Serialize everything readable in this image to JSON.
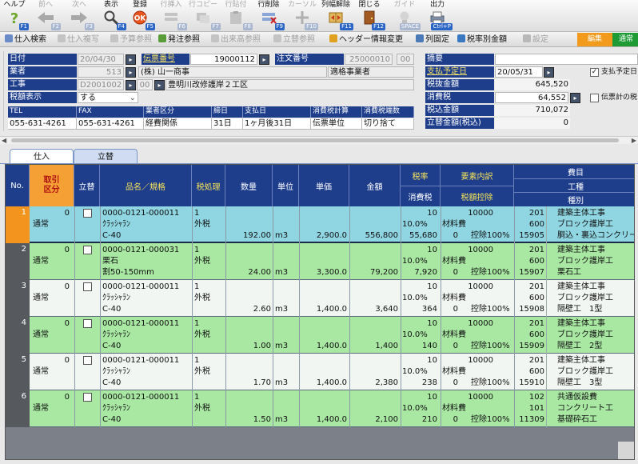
{
  "toolbar": [
    {
      "label": "ヘルプ",
      "key": "F1",
      "icon": "help-icon",
      "enabled": true
    },
    {
      "label": "前へ",
      "key": "F2",
      "icon": "arrow-left-icon",
      "enabled": false
    },
    {
      "label": "次へ",
      "key": "F3",
      "icon": "arrow-right-icon",
      "enabled": false
    },
    {
      "label": "表示",
      "key": "F4",
      "icon": "search-icon",
      "enabled": true
    },
    {
      "label": "登録",
      "key": "F5",
      "icon": "ok-icon",
      "enabled": true
    },
    {
      "label": "行挿入",
      "key": "F6",
      "icon": "row-insert-icon",
      "enabled": false
    },
    {
      "label": "行コピー",
      "key": "F7",
      "icon": "row-copy-icon",
      "enabled": false
    },
    {
      "label": "行貼付",
      "key": "F8",
      "icon": "row-paste-icon",
      "enabled": false
    },
    {
      "label": "行削除",
      "key": "F9",
      "icon": "row-delete-icon",
      "enabled": true
    },
    {
      "label": "カーソル",
      "key": "F10",
      "icon": "cursor-icon",
      "enabled": false
    },
    {
      "label": "列幅解除",
      "key": "F11",
      "icon": "column-width-icon",
      "enabled": true
    },
    {
      "label": "閉じる",
      "key": "F12",
      "icon": "close-door-icon",
      "enabled": true
    },
    {
      "label": "ガイド",
      "key": "SPACE",
      "icon": "guide-bulb-icon",
      "enabled": false
    },
    {
      "label": "出力",
      "key": "Ctrl+P",
      "icon": "printer-icon",
      "enabled": true
    }
  ],
  "toolbar2": [
    {
      "label": "仕入検索",
      "icon": "search-icon",
      "enabled": true
    },
    {
      "label": "仕入複写",
      "icon": "copy-icon",
      "enabled": false
    },
    {
      "label": "予算参照",
      "icon": "budget-icon",
      "enabled": false
    },
    {
      "label": "発注参照",
      "icon": "order-icon",
      "enabled": true
    },
    {
      "label": "出来高参照",
      "icon": "progress-icon",
      "enabled": false
    },
    {
      "label": "立替参照",
      "icon": "advance-icon",
      "enabled": false
    },
    {
      "label": "ヘッダー情報変更",
      "icon": "header-edit-icon",
      "enabled": true
    },
    {
      "label": "列固定",
      "icon": "column-lock-icon",
      "enabled": true
    },
    {
      "label": "税率別金額",
      "icon": "tax-rate-icon",
      "enabled": true
    },
    {
      "label": "設定",
      "icon": "settings-icon",
      "enabled": false
    }
  ],
  "mode_buttons": {
    "edit": "編集",
    "normal": "通常"
  },
  "header": {
    "date_label": "日付",
    "date": "20/04/30",
    "slip_label": "伝票番号",
    "slip_no": "19000112",
    "order_label": "注文番号",
    "order_no1": "25000010",
    "order_no2": "00",
    "vendor_label": "業者",
    "vendor_code": "513",
    "vendor_name": "(株) 山一商事",
    "vendor_type": "適格事業者",
    "work_label": "工事",
    "work_code": "D2001002",
    "work_sub": "00",
    "work_name": "豊明川改修護岸２工区",
    "tax_label": "税額表示",
    "tax_value": "する",
    "grid_headers": [
      "TEL",
      "FAX",
      "業者区分",
      "締日",
      "支払日",
      "消費税計算",
      "消費税端数"
    ],
    "grid_values": [
      "055-631-4261",
      "055-631-4261",
      "経費関係",
      "31日",
      "1ヶ月後31日",
      "伝票単位",
      "切り捨て"
    ]
  },
  "summary": {
    "memo_label": "摘要",
    "memo": "",
    "pay_due_label": "支払予定日",
    "pay_due": "20/05/31",
    "excl_label": "税抜金額",
    "excl": "645,520",
    "tax_label": "消費税",
    "tax": "64,552",
    "incl_label": "税込金額",
    "incl": "710,072",
    "advance_label": "立替金額(税込)",
    "advance": "0",
    "chk_pay_due": "支払予定日",
    "chk_slip_tax": "伝票計の税"
  },
  "tabs": [
    {
      "label": "仕入",
      "active": true
    },
    {
      "label": "立替",
      "active": false
    }
  ],
  "columns": {
    "no": "No.",
    "kbn": "取引\n区分",
    "tatekae": "立替",
    "item": "品名／規格",
    "taxproc": "税処理",
    "qty": "数量",
    "unit": "単位",
    "price": "単価",
    "amount": "金額",
    "taxrate": "税率",
    "consumption": "消費税",
    "element": "要素内訳",
    "deduction": "税額控除",
    "cost": "費目",
    "process": "工種",
    "kind": "種別"
  },
  "rows": [
    {
      "no": "1",
      "kbn_code": "0",
      "kbn": "通常",
      "code": "0000-0121-000011",
      "name": "ｸﾗｯｼｬﾗﾝ",
      "spec": "C-40",
      "tax_code": "1",
      "tax": "外税",
      "qty": "192.00",
      "unit": "m3",
      "price": "2,900.0",
      "amount": "556,800",
      "rate_val": "10",
      "rate": "10.0%",
      "ctax": "55,680",
      "el_code": "10000",
      "el": "材料費",
      "el_sub": "0",
      "deduct": "控除100%",
      "cost_code": "201",
      "cost": "建築主体工事",
      "proc_code": "600",
      "proc": "ブロック護岸工",
      "kind_code": "15905",
      "kind": "胴込・裏込コンクリート料",
      "selected": true
    },
    {
      "no": "2",
      "kbn_code": "0",
      "kbn": "通常",
      "code": "0000-0121-000031",
      "name": "栗石",
      "spec": "割50-150mm",
      "tax_code": "1",
      "tax": "外税",
      "qty": "24.00",
      "unit": "m3",
      "price": "3,300.0",
      "amount": "79,200",
      "rate_val": "10",
      "rate": "10.0%",
      "ctax": "7,920",
      "el_code": "10000",
      "el": "材料費",
      "el_sub": "0",
      "deduct": "控除100%",
      "cost_code": "201",
      "cost": "建築主体工事",
      "proc_code": "600",
      "proc": "ブロック護岸工",
      "kind_code": "15907",
      "kind": "栗石工",
      "selected": false
    },
    {
      "no": "3",
      "kbn_code": "0",
      "kbn": "通常",
      "code": "0000-0121-000011",
      "name": "ｸﾗｯｼｬﾗﾝ",
      "spec": "C-40",
      "tax_code": "1",
      "tax": "外税",
      "qty": "2.60",
      "unit": "m3",
      "price": "1,400.0",
      "amount": "3,640",
      "rate_val": "10",
      "rate": "10.0%",
      "ctax": "364",
      "el_code": "10000",
      "el": "材料費",
      "el_sub": "0",
      "deduct": "控除100%",
      "cost_code": "201",
      "cost": "建築主体工事",
      "proc_code": "600",
      "proc": "ブロック護岸工",
      "kind_code": "15908",
      "kind": "隔壁工　1型",
      "selected": false
    },
    {
      "no": "4",
      "kbn_code": "0",
      "kbn": "通常",
      "code": "0000-0121-000011",
      "name": "ｸﾗｯｼｬﾗﾝ",
      "spec": "C-40",
      "tax_code": "1",
      "tax": "外税",
      "qty": "1.00",
      "unit": "m3",
      "price": "1,400.0",
      "amount": "1,400",
      "rate_val": "10",
      "rate": "10.0%",
      "ctax": "140",
      "el_code": "10000",
      "el": "材料費",
      "el_sub": "0",
      "deduct": "控除100%",
      "cost_code": "201",
      "cost": "建築主体工事",
      "proc_code": "600",
      "proc": "ブロック護岸工",
      "kind_code": "15909",
      "kind": "隔壁工　2型",
      "selected": false
    },
    {
      "no": "5",
      "kbn_code": "0",
      "kbn": "通常",
      "code": "0000-0121-000011",
      "name": "ｸﾗｯｼｬﾗﾝ",
      "spec": "C-40",
      "tax_code": "1",
      "tax": "外税",
      "qty": "1.70",
      "unit": "m3",
      "price": "1,400.0",
      "amount": "2,380",
      "rate_val": "10",
      "rate": "10.0%",
      "ctax": "238",
      "el_code": "10000",
      "el": "材料費",
      "el_sub": "0",
      "deduct": "控除100%",
      "cost_code": "201",
      "cost": "建築主体工事",
      "proc_code": "600",
      "proc": "ブロック護岸工",
      "kind_code": "15910",
      "kind": "隔壁工　3型",
      "selected": false
    },
    {
      "no": "6",
      "kbn_code": "0",
      "kbn": "通常",
      "code": "0000-0121-000011",
      "name": "ｸﾗｯｼｬﾗﾝ",
      "spec": "C-40",
      "tax_code": "1",
      "tax": "外税",
      "qty": "1.50",
      "unit": "m3",
      "price": "1,400.0",
      "amount": "2,100",
      "rate_val": "10",
      "rate": "10.0%",
      "ctax": "210",
      "el_code": "10000",
      "el": "材料費",
      "el_sub": "0",
      "deduct": "控除100%",
      "cost_code": "102",
      "cost": "共通仮設費",
      "proc_code": "101",
      "proc": "コンクリート工",
      "kind_code": "11309",
      "kind": "基礎砕石工",
      "selected": false
    }
  ],
  "colors": {
    "navy": "#1e3e8c",
    "row_sel": "#8fd6e2",
    "row_green": "#a9e8a3",
    "row_white": "#f2f6f2",
    "orange": "#f5a035",
    "edit_btn": "#f29a1b",
    "normal_btn": "#1f9b36"
  }
}
